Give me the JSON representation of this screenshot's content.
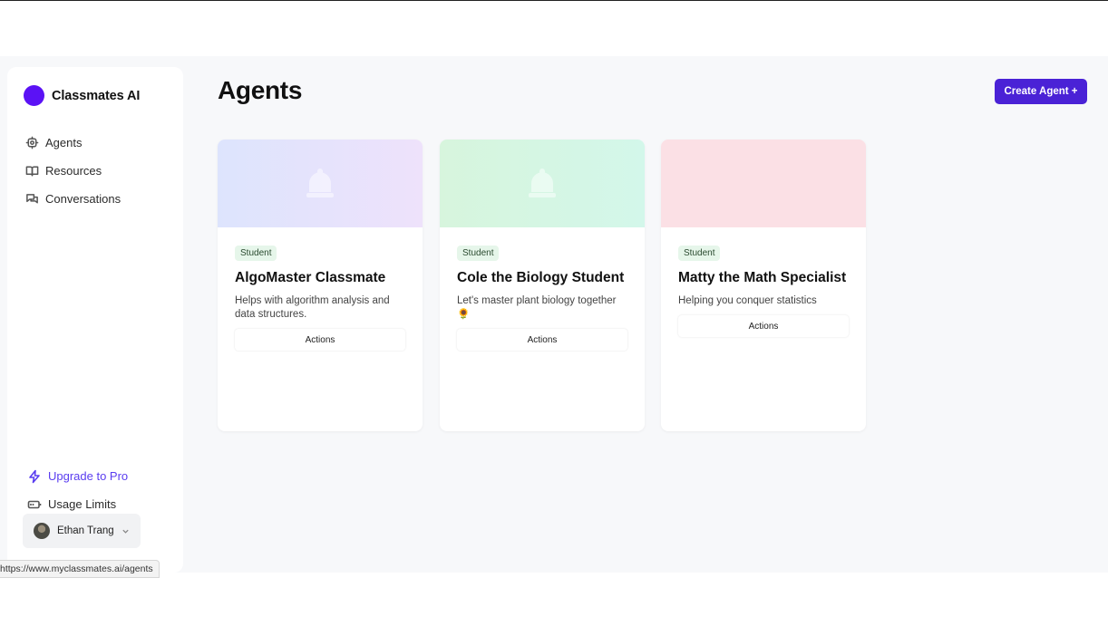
{
  "brand": {
    "name": "Classmates AI",
    "logo_color": "#5b12f5"
  },
  "sidebar": {
    "items": [
      {
        "label": "Agents",
        "icon": "gear-icon"
      },
      {
        "label": "Resources",
        "icon": "book-icon"
      },
      {
        "label": "Conversations",
        "icon": "chat-icon"
      }
    ],
    "upgrade_label": "Upgrade to Pro",
    "usage_label": "Usage Limits",
    "user_name": "Ethan Trang"
  },
  "page": {
    "title": "Agents",
    "create_button": "Create Agent +",
    "accent_color": "#4a22d6"
  },
  "agents": [
    {
      "badge": "Student",
      "name": "AlgoMaster Classmate",
      "description": "Helps with algorithm analysis and data structures.",
      "actions_label": "Actions",
      "banner_color": "#dde4fd"
    },
    {
      "badge": "Student",
      "name": "Cole the Biology Student",
      "description": "Let's master plant biology together 🌻",
      "actions_label": "Actions",
      "banner_color": "#d7f5dd"
    },
    {
      "badge": "Student",
      "name": "Matty the Math Specialist",
      "description": "Helping you conquer statistics",
      "actions_label": "Actions",
      "banner_color": "#fbe0e5"
    }
  ],
  "status_bar": {
    "url": "https://www.myclassmates.ai/agents"
  }
}
